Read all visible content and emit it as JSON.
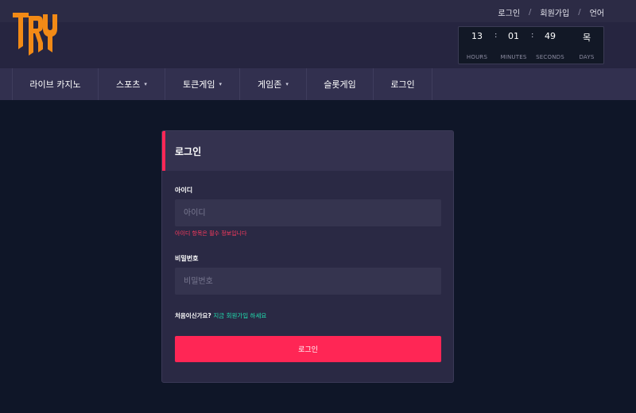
{
  "top_links": [
    "로그인",
    "회원가입",
    "언어"
  ],
  "countdown": {
    "hours": "13",
    "minutes": "01",
    "seconds": "49",
    "days": "목",
    "labels": {
      "hours": "HOURS",
      "minutes": "MINUTES",
      "seconds": "SECONDS",
      "days": "DAYS"
    }
  },
  "nav": [
    {
      "label": "라이브 카지노",
      "dropdown": false
    },
    {
      "label": "스포츠",
      "dropdown": true
    },
    {
      "label": "토큰게임",
      "dropdown": true
    },
    {
      "label": "게임존",
      "dropdown": true
    },
    {
      "label": "슬롯게임",
      "dropdown": false
    },
    {
      "label": "로그인",
      "dropdown": false
    }
  ],
  "login": {
    "title": "로그인",
    "id_label": "아이디",
    "id_placeholder": "아이디",
    "id_value": "",
    "id_error": "아이디 항목은 필수 정보입니다",
    "pw_label": "비밀번호",
    "pw_placeholder": "비밀번호",
    "pw_value": "",
    "signup_prompt": "처음이신가요?",
    "signup_link": "지금 회원가입 하세요",
    "submit_label": "로그인"
  },
  "colors": {
    "accent": "#ff2655",
    "link": "#20e0b0",
    "logo_orange": "#f28a16"
  },
  "icons": [
    "logo-icon",
    "caret-down-icon"
  ]
}
